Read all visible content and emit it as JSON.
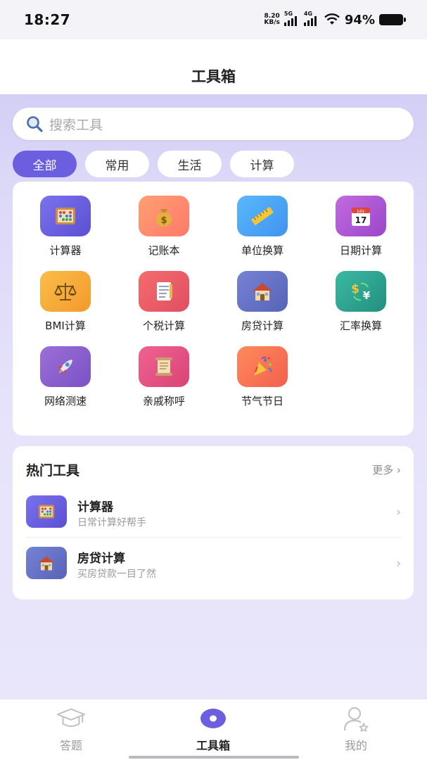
{
  "status_bar": {
    "time": "18:27",
    "net_speed_value": "8.20",
    "net_speed_unit": "KB/s",
    "signal_1": "5G",
    "signal_2": "4G",
    "battery": "94%"
  },
  "header": {
    "title": "工具箱"
  },
  "search": {
    "placeholder": "搜索工具",
    "icon": "search-icon"
  },
  "chips": [
    {
      "label": "全部",
      "active": true
    },
    {
      "label": "常用",
      "active": false
    },
    {
      "label": "生活",
      "active": false
    },
    {
      "label": "计算",
      "active": false
    }
  ],
  "tools": [
    {
      "label": "计算器",
      "icon": "abacus-icon",
      "color": "#6d63e0"
    },
    {
      "label": "记账本",
      "icon": "money-bag-icon",
      "color": "#ff8a6a"
    },
    {
      "label": "单位换算",
      "icon": "ruler-icon",
      "color": "#4aa8f5"
    },
    {
      "label": "日期计算",
      "icon": "calendar-icon",
      "color": "#b45cd8"
    },
    {
      "label": "BMI计算",
      "icon": "scale-icon",
      "color": "#f8a73c"
    },
    {
      "label": "个税计算",
      "icon": "document-icon",
      "color": "#ec5f6a"
    },
    {
      "label": "房贷计算",
      "icon": "house-icon",
      "color": "#6673c6"
    },
    {
      "label": "汇率换算",
      "icon": "currency-exchange-icon",
      "color": "#2eaa96"
    },
    {
      "label": "网络测速",
      "icon": "rocket-icon",
      "color": "#8e63d0"
    },
    {
      "label": "亲戚称呼",
      "icon": "scroll-icon",
      "color": "#e95a8c"
    },
    {
      "label": "节气节日",
      "icon": "party-popper-icon",
      "color": "#f57a55"
    }
  ],
  "hot": {
    "title": "热门工具",
    "more": "更多 ›",
    "items": [
      {
        "name": "计算器",
        "desc": "日常计算好帮手",
        "icon": "abacus-icon",
        "color": "#6d63e0"
      },
      {
        "name": "房贷计算",
        "desc": "买房贷款一目了然",
        "icon": "house-icon",
        "color": "#6673c6"
      }
    ]
  },
  "nav": [
    {
      "label": "答题",
      "icon": "graduation-cap-icon",
      "active": false
    },
    {
      "label": "工具箱",
      "icon": "toolbox-icon",
      "active": true
    },
    {
      "label": "我的",
      "icon": "user-icon",
      "active": false
    }
  ]
}
